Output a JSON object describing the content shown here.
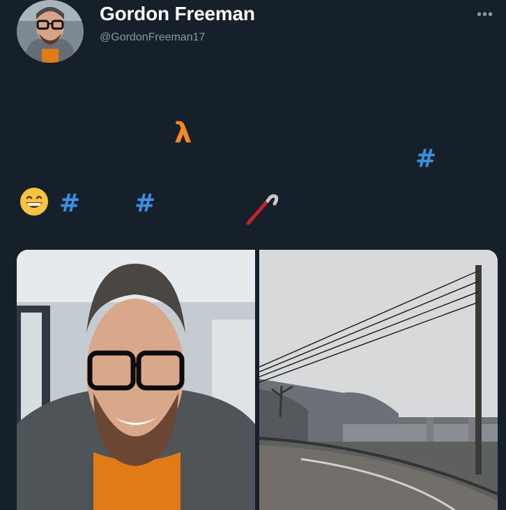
{
  "post": {
    "author_name": "Gordon Freeman",
    "author_handle": "@GordonFreeman17",
    "more_icon": "more-horizontal-icon"
  },
  "body_symbols": {
    "lambda": "λ",
    "hash": "#",
    "emoji": "grinning-face-emoji",
    "crowbar": "crowbar-icon"
  },
  "media": [
    {
      "name": "selfie-photo"
    },
    {
      "name": "road-landscape-photo"
    }
  ],
  "colors": {
    "background": "#15202b",
    "name_text": "#ffffff",
    "handle_text": "#8899a6",
    "lambda_orange": "#f5891f",
    "hash_blue": "#3b8fe0"
  }
}
